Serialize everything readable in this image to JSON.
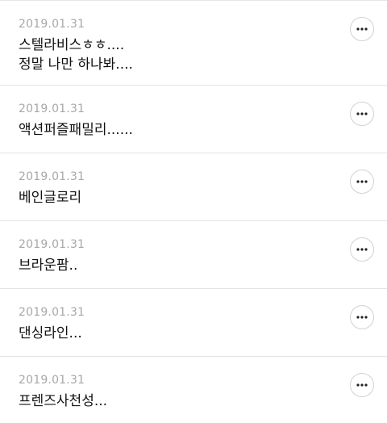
{
  "comments": [
    {
      "date": "2019.01.31",
      "text": "스텔라비스ㅎㅎ....\n정말 나만 하나봐....",
      "more_icon": "more-horizontal-icon"
    },
    {
      "date": "2019.01.31",
      "text": "액션퍼즐패밀리......",
      "more_icon": "more-horizontal-icon"
    },
    {
      "date": "2019.01.31",
      "text": "베인글로리",
      "more_icon": "more-horizontal-icon"
    },
    {
      "date": "2019.01.31",
      "text": "브라운팜..",
      "more_icon": "more-horizontal-icon"
    },
    {
      "date": "2019.01.31",
      "text": "댄싱라인...",
      "more_icon": "more-horizontal-icon"
    },
    {
      "date": "2019.01.31",
      "text": "프렌즈사천성...",
      "more_icon": "more-horizontal-icon"
    }
  ]
}
